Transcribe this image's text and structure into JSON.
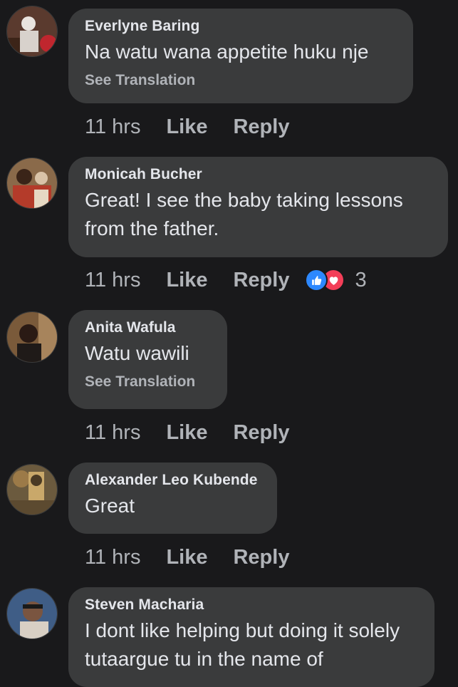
{
  "comments": [
    {
      "author": "Everlyne Baring",
      "text": "Na watu wana appetite huku nje",
      "see_translation": "See Translation",
      "time": "11 hrs",
      "like": "Like",
      "reply": "Reply"
    },
    {
      "author": "Monicah Bucher",
      "text": "Great! I see the baby taking lessons from the father.",
      "time": "11 hrs",
      "like": "Like",
      "reply": "Reply",
      "reaction_count": "3",
      "reactions": [
        "like",
        "love"
      ]
    },
    {
      "author": "Anita Wafula",
      "text": "Watu wawili",
      "see_translation": "See Translation",
      "time": "11 hrs",
      "like": "Like",
      "reply": "Reply"
    },
    {
      "author": "Alexander Leo Kubende",
      "text": "Great",
      "time": "11 hrs",
      "like": "Like",
      "reply": "Reply"
    },
    {
      "author": "Steven Macharia",
      "text": "I dont like helping but doing it solely tutaargue tu in the name of",
      "time": "",
      "like": "",
      "reply": ""
    }
  ],
  "colors": {
    "background": "#19191b",
    "bubble": "#3a3b3c",
    "primary_text": "#e4e6eb",
    "secondary_text": "#b0b3b8",
    "like_reaction": "#2d88ff",
    "love_reaction": "#f33e58"
  }
}
